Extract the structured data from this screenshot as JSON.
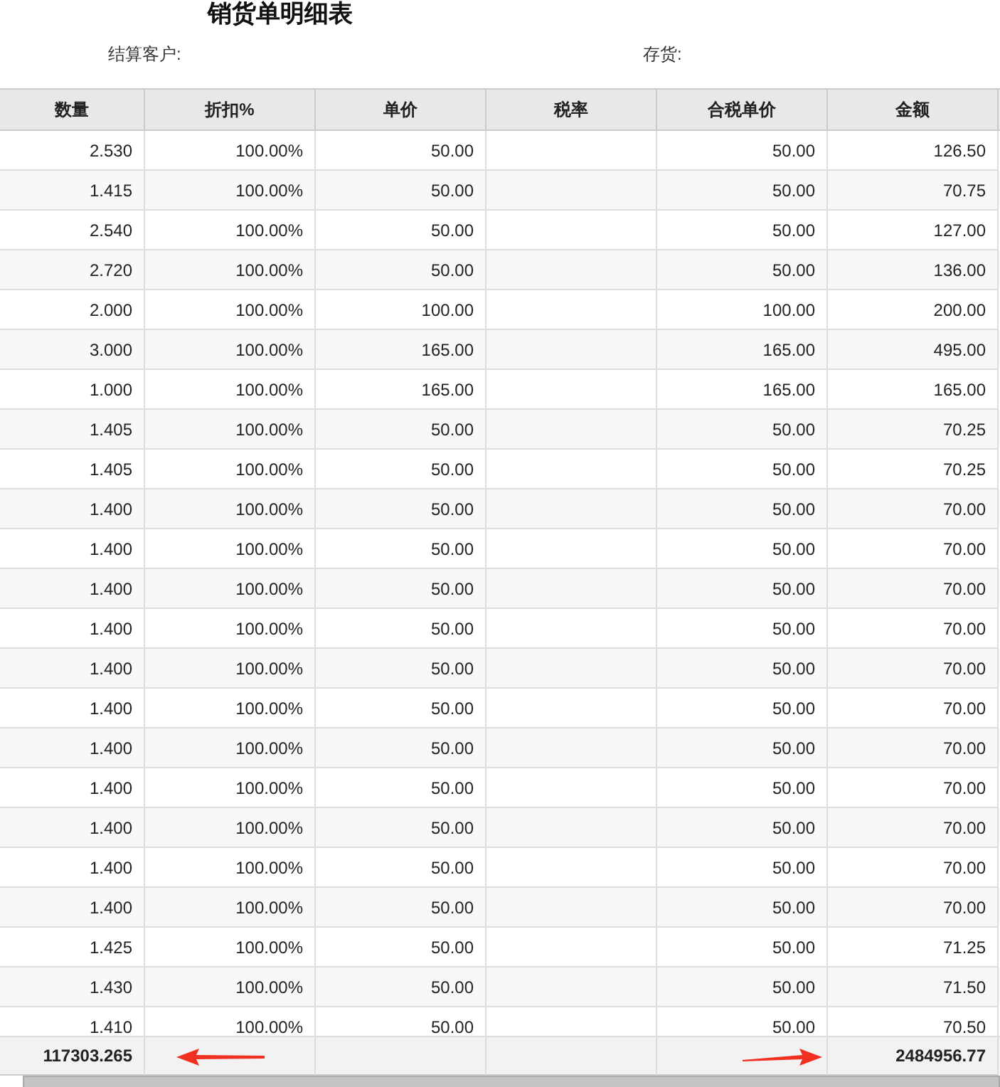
{
  "title": "销货单明细表",
  "filters": [
    {
      "label": "结算客户:"
    },
    {
      "label": "存货:"
    }
  ],
  "columns": [
    "数量",
    "折扣%",
    "单价",
    "税率",
    "合税单价",
    "金额"
  ],
  "rows": [
    {
      "quantity": "2.530",
      "discount": "100.00%",
      "unit_price": "50.00",
      "tax_unit_price": "50.00",
      "amount": "126.50"
    },
    {
      "quantity": "1.415",
      "discount": "100.00%",
      "unit_price": "50.00",
      "tax_unit_price": "50.00",
      "amount": "70.75"
    },
    {
      "quantity": "2.540",
      "discount": "100.00%",
      "unit_price": "50.00",
      "tax_unit_price": "50.00",
      "amount": "127.00"
    },
    {
      "quantity": "2.720",
      "discount": "100.00%",
      "unit_price": "50.00",
      "tax_unit_price": "50.00",
      "amount": "136.00"
    },
    {
      "quantity": "2.000",
      "discount": "100.00%",
      "unit_price": "100.00",
      "tax_unit_price": "100.00",
      "amount": "200.00"
    },
    {
      "quantity": "3.000",
      "discount": "100.00%",
      "unit_price": "165.00",
      "tax_unit_price": "165.00",
      "amount": "495.00"
    },
    {
      "quantity": "1.000",
      "discount": "100.00%",
      "unit_price": "165.00",
      "tax_unit_price": "165.00",
      "amount": "165.00"
    },
    {
      "quantity": "1.405",
      "discount": "100.00%",
      "unit_price": "50.00",
      "tax_unit_price": "50.00",
      "amount": "70.25"
    },
    {
      "quantity": "1.405",
      "discount": "100.00%",
      "unit_price": "50.00",
      "tax_unit_price": "50.00",
      "amount": "70.25"
    },
    {
      "quantity": "1.400",
      "discount": "100.00%",
      "unit_price": "50.00",
      "tax_unit_price": "50.00",
      "amount": "70.00"
    },
    {
      "quantity": "1.400",
      "discount": "100.00%",
      "unit_price": "50.00",
      "tax_unit_price": "50.00",
      "amount": "70.00"
    },
    {
      "quantity": "1.400",
      "discount": "100.00%",
      "unit_price": "50.00",
      "tax_unit_price": "50.00",
      "amount": "70.00"
    },
    {
      "quantity": "1.400",
      "discount": "100.00%",
      "unit_price": "50.00",
      "tax_unit_price": "50.00",
      "amount": "70.00"
    },
    {
      "quantity": "1.400",
      "discount": "100.00%",
      "unit_price": "50.00",
      "tax_unit_price": "50.00",
      "amount": "70.00"
    },
    {
      "quantity": "1.400",
      "discount": "100.00%",
      "unit_price": "50.00",
      "tax_unit_price": "50.00",
      "amount": "70.00"
    },
    {
      "quantity": "1.400",
      "discount": "100.00%",
      "unit_price": "50.00",
      "tax_unit_price": "50.00",
      "amount": "70.00"
    },
    {
      "quantity": "1.400",
      "discount": "100.00%",
      "unit_price": "50.00",
      "tax_unit_price": "50.00",
      "amount": "70.00"
    },
    {
      "quantity": "1.400",
      "discount": "100.00%",
      "unit_price": "50.00",
      "tax_unit_price": "50.00",
      "amount": "70.00"
    },
    {
      "quantity": "1.400",
      "discount": "100.00%",
      "unit_price": "50.00",
      "tax_unit_price": "50.00",
      "amount": "70.00"
    },
    {
      "quantity": "1.400",
      "discount": "100.00%",
      "unit_price": "50.00",
      "tax_unit_price": "50.00",
      "amount": "70.00"
    },
    {
      "quantity": "1.425",
      "discount": "100.00%",
      "unit_price": "50.00",
      "tax_unit_price": "50.00",
      "amount": "71.25"
    },
    {
      "quantity": "1.430",
      "discount": "100.00%",
      "unit_price": "50.00",
      "tax_unit_price": "50.00",
      "amount": "71.50"
    },
    {
      "quantity": "1.410",
      "discount": "100.00%",
      "unit_price": "50.00",
      "tax_unit_price": "50.00",
      "amount": "70.50"
    }
  ],
  "totals": {
    "quantity": "117303.265",
    "amount": "2484956.77"
  }
}
